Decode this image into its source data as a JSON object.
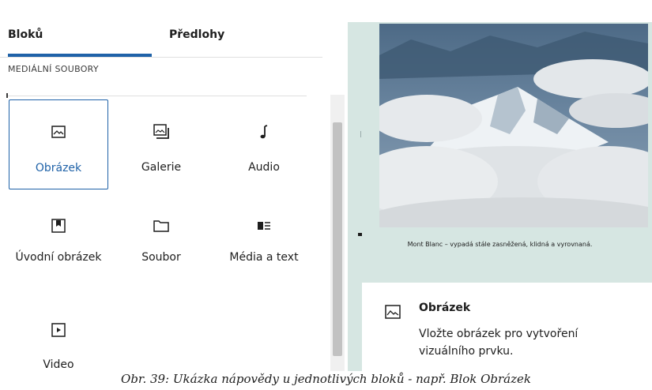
{
  "tabs": [
    {
      "label": "Bloků",
      "active": true
    },
    {
      "label": "Předlohy",
      "active": false
    }
  ],
  "section": {
    "title": "MEDIÁLNÍ SOUBORY"
  },
  "blocks": [
    {
      "label": "Obrázek",
      "icon": "image-icon",
      "selected": true
    },
    {
      "label": "Galerie",
      "icon": "gallery-icon"
    },
    {
      "label": "Audio",
      "icon": "audio-icon"
    },
    {
      "label": "Úvodní obrázek",
      "icon": "cover-image-icon"
    },
    {
      "label": "Soubor",
      "icon": "file-icon"
    },
    {
      "label": "Média a text",
      "icon": "media-text-icon"
    },
    {
      "label": "Video",
      "icon": "video-icon"
    }
  ],
  "preview": {
    "caption": "Mont Blanc – vypadá stále zasněžená, klidná a vyrovnaná."
  },
  "help": {
    "icon": "image-icon",
    "title": "Obrázek",
    "description": "Vložte obrázek pro vytvoření vizuálního prvku."
  },
  "document_caption": "Obr. 39: Ukázka nápovědy u jednotlivých bloků - např. Blok Obrázek",
  "colors": {
    "accent": "#1f62a8",
    "preview_bg": "#d6e6e2"
  }
}
